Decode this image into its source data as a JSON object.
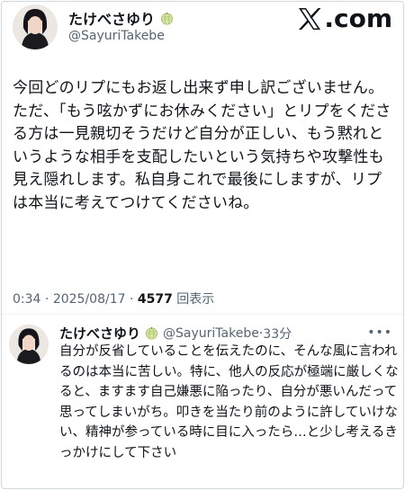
{
  "tweet": {
    "author": {
      "name": "たけべさゆり",
      "handle": "@SayuriTakebe",
      "badge_icon": "melon-icon",
      "avatar": "avatar"
    },
    "brand": {
      "logo_icon": "x-logo-icon",
      "domain_suffix": ".com"
    },
    "text": "今回どのリプにもお返し出来ず申し訳ございません。\nただ、「もう呟かずにお休みください」とリプをくださる方は一見親切そうだけど自分が正しい、もう黙れというような相手を支配したいという気持ちや攻撃性も見え隠れします。私自身これで最後にしますが、リプは本当に考えてつけてくださいね。",
    "meta": {
      "time": "0:34",
      "separator": " · ",
      "date": "2025/08/17",
      "views_count": "4577",
      "views_label": " 回表示"
    }
  },
  "reply": {
    "author": {
      "name": "たけべさゆり",
      "handle": "@SayuriTakebe",
      "badge_icon": "melon-icon"
    },
    "time_sep": "·",
    "time": "33分",
    "more_icon": "more-options-icon",
    "text": "自分が反省していることを伝えたのに、そんな風に言われるのは本当に苦しい。特に、他人の反応が極端に厳しくなると、ますます自己嫌悪に陥ったり、自分が悪いんだって思ってしまいがち。叩きを当たり前のように許していけない、精神が参っている時に目に入ったら…と少し考えるきっかけにして下さい"
  }
}
